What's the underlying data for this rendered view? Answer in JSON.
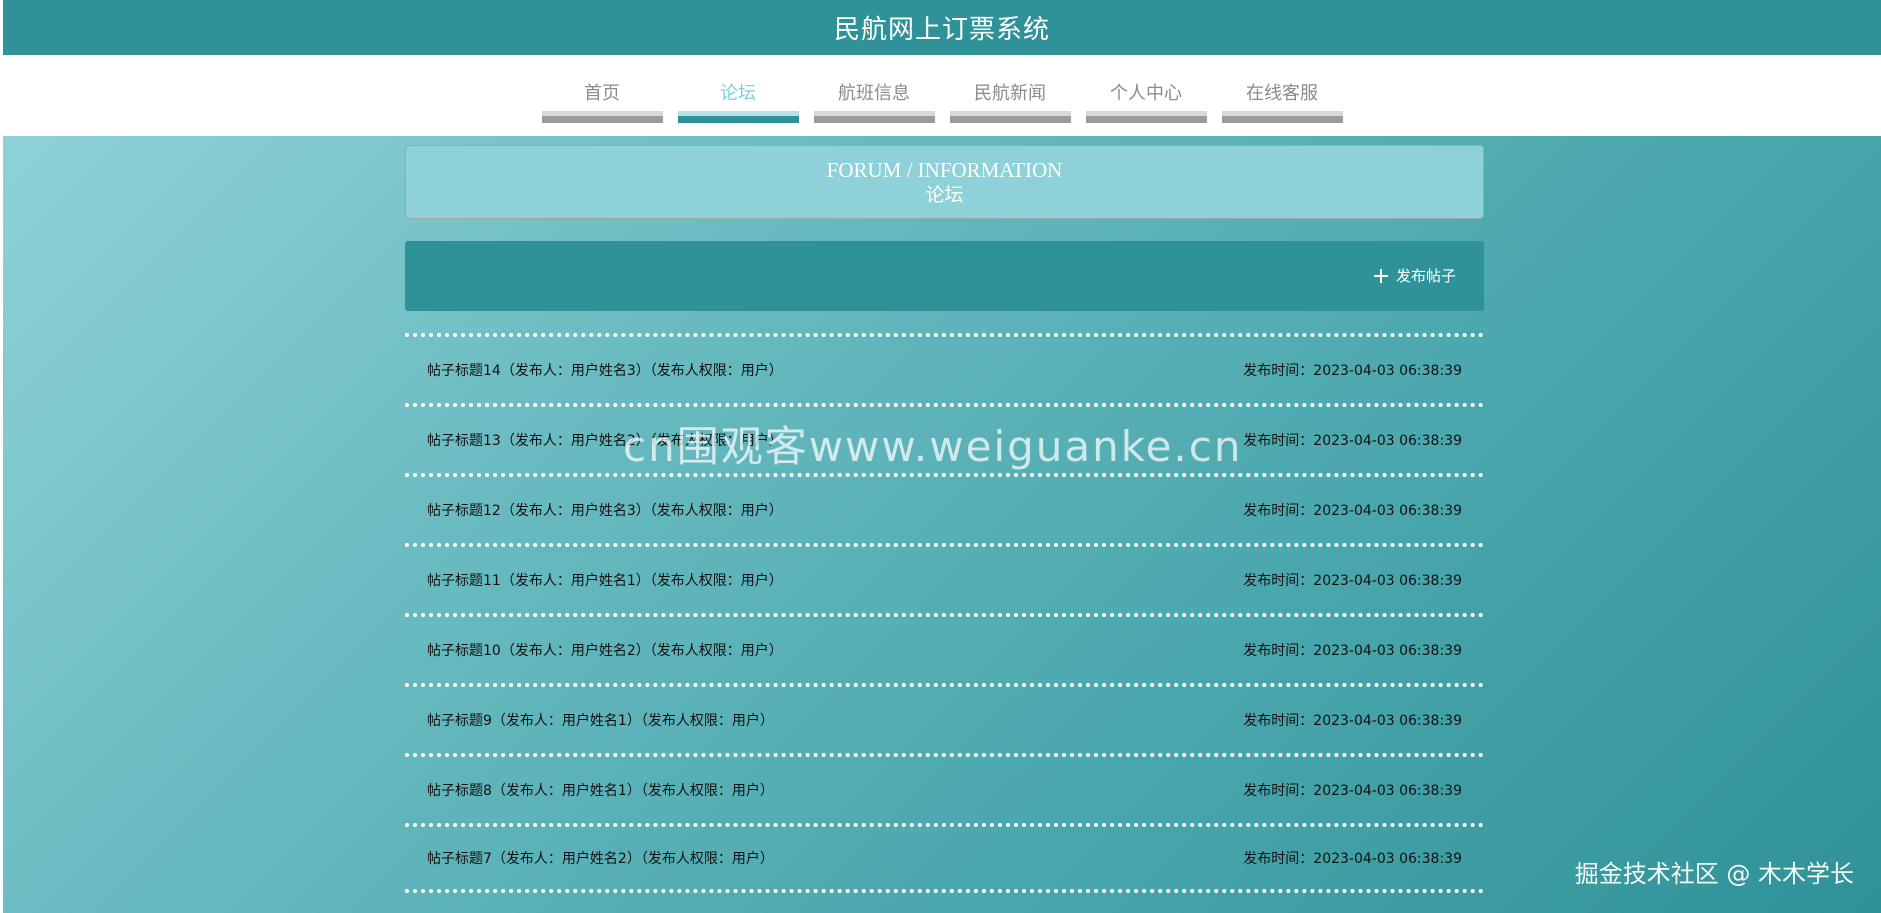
{
  "header": {
    "title": "民航网上订票系统"
  },
  "nav": {
    "items": [
      {
        "label": "首页"
      },
      {
        "label": "论坛"
      },
      {
        "label": "航班信息"
      },
      {
        "label": "民航新闻"
      },
      {
        "label": "个人中心"
      },
      {
        "label": "在线客服"
      }
    ],
    "active": "论坛"
  },
  "section": {
    "title_en": "FORUM / INFORMATION",
    "title_zh": "论坛"
  },
  "toolbar": {
    "post_label": "发布帖子",
    "post_icon": "plus-icon"
  },
  "posts": [
    {
      "title": "帖子标题14",
      "author": "用户姓名3",
      "role": "用户",
      "time": "2023-04-03 06:38:39"
    },
    {
      "title": "帖子标题13",
      "author": "用户姓名2",
      "role": "用户",
      "time": "2023-04-03 06:38:39"
    },
    {
      "title": "帖子标题12",
      "author": "用户姓名3",
      "role": "用户",
      "time": "2023-04-03 06:38:39"
    },
    {
      "title": "帖子标题11",
      "author": "用户姓名1",
      "role": "用户",
      "time": "2023-04-03 06:38:39"
    },
    {
      "title": "帖子标题10",
      "author": "用户姓名2",
      "role": "用户",
      "time": "2023-04-03 06:38:39"
    },
    {
      "title": "帖子标题9",
      "author": "用户姓名1",
      "role": "用户",
      "time": "2023-04-03 06:38:39"
    },
    {
      "title": "帖子标题8",
      "author": "用户姓名1",
      "role": "用户",
      "time": "2023-04-03 06:38:39"
    },
    {
      "title": "帖子标题7",
      "author": "用户姓名2",
      "role": "用户",
      "time": "2023-04-03 06:38:39"
    }
  ],
  "labels": {
    "author_prefix": "（发布人：",
    "author_suffix": "）",
    "role_prefix": "（发布人权限：",
    "role_suffix": "）",
    "time_prefix": "发布时间："
  },
  "watermarks": {
    "center": "cn围观客www.weiguanke.cn",
    "corner": "掘金技术社区 @ 木木学长"
  },
  "colors": {
    "primary": "#2f9298",
    "active_nav_text": "#81cfd5",
    "header_panel": "#8fd1d8"
  }
}
